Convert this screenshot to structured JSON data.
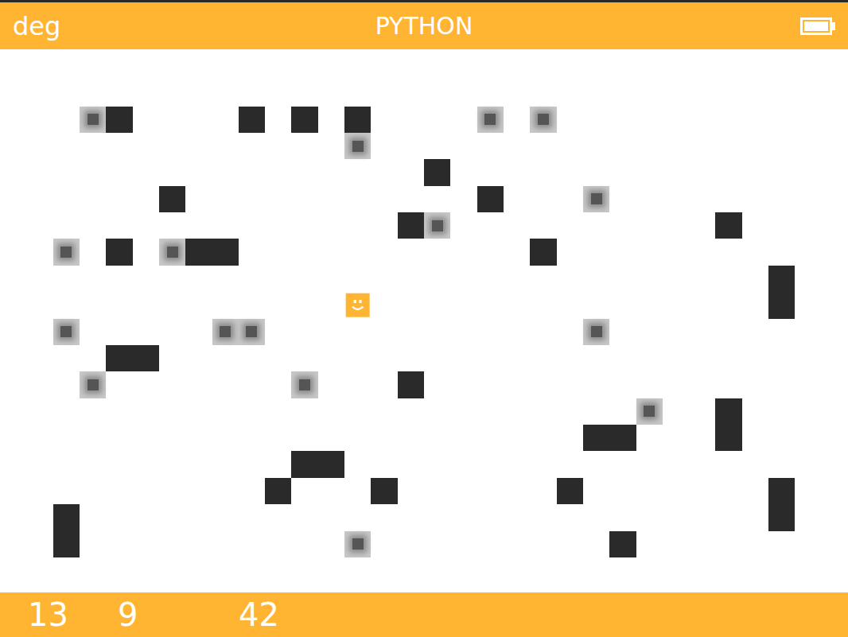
{
  "status_bar": {
    "angle_unit": "deg",
    "title": "PYTHON",
    "battery": {
      "level": 1
    }
  },
  "board": {
    "columns": 32,
    "rows": 24,
    "tiles": [
      {
        "kind": "crate",
        "col": 3,
        "row": 4
      },
      {
        "kind": "wall",
        "col": 4,
        "row": 4
      },
      {
        "kind": "wall",
        "col": 9,
        "row": 4
      },
      {
        "kind": "wall",
        "col": 11,
        "row": 4
      },
      {
        "kind": "wall",
        "col": 13,
        "row": 4
      },
      {
        "kind": "crate",
        "col": 18,
        "row": 4
      },
      {
        "kind": "crate",
        "col": 20,
        "row": 4
      },
      {
        "kind": "crate",
        "col": 13,
        "row": 5
      },
      {
        "kind": "wall",
        "col": 16,
        "row": 6
      },
      {
        "kind": "wall",
        "col": 6,
        "row": 7
      },
      {
        "kind": "wall",
        "col": 18,
        "row": 7
      },
      {
        "kind": "crate",
        "col": 22,
        "row": 7
      },
      {
        "kind": "wall",
        "col": 15,
        "row": 8
      },
      {
        "kind": "crate",
        "col": 16,
        "row": 8
      },
      {
        "kind": "wall",
        "col": 27,
        "row": 8
      },
      {
        "kind": "crate",
        "col": 2,
        "row": 9
      },
      {
        "kind": "wall",
        "col": 4,
        "row": 9
      },
      {
        "kind": "crate",
        "col": 6,
        "row": 9
      },
      {
        "kind": "wall",
        "col": 7,
        "row": 9
      },
      {
        "kind": "wall",
        "col": 8,
        "row": 9
      },
      {
        "kind": "wall",
        "col": 20,
        "row": 9
      },
      {
        "kind": "wall",
        "col": 29,
        "row": 10
      },
      {
        "kind": "wall",
        "col": 29,
        "row": 11
      },
      {
        "kind": "player",
        "col": 13,
        "row": 11
      },
      {
        "kind": "crate",
        "col": 2,
        "row": 12
      },
      {
        "kind": "crate",
        "col": 8,
        "row": 12
      },
      {
        "kind": "crate",
        "col": 9,
        "row": 12
      },
      {
        "kind": "crate",
        "col": 22,
        "row": 12
      },
      {
        "kind": "wall",
        "col": 4,
        "row": 13
      },
      {
        "kind": "wall",
        "col": 5,
        "row": 13
      },
      {
        "kind": "crate",
        "col": 3,
        "row": 14
      },
      {
        "kind": "crate",
        "col": 11,
        "row": 14
      },
      {
        "kind": "wall",
        "col": 15,
        "row": 14
      },
      {
        "kind": "crate",
        "col": 24,
        "row": 15
      },
      {
        "kind": "wall",
        "col": 27,
        "row": 15
      },
      {
        "kind": "wall",
        "col": 27,
        "row": 16
      },
      {
        "kind": "wall",
        "col": 22,
        "row": 16
      },
      {
        "kind": "wall",
        "col": 23,
        "row": 16
      },
      {
        "kind": "wall",
        "col": 11,
        "row": 17
      },
      {
        "kind": "wall",
        "col": 12,
        "row": 17
      },
      {
        "kind": "wall",
        "col": 10,
        "row": 18
      },
      {
        "kind": "wall",
        "col": 14,
        "row": 18
      },
      {
        "kind": "wall",
        "col": 21,
        "row": 18
      },
      {
        "kind": "wall",
        "col": 29,
        "row": 18
      },
      {
        "kind": "wall",
        "col": 29,
        "row": 19
      },
      {
        "kind": "wall",
        "col": 2,
        "row": 19
      },
      {
        "kind": "wall",
        "col": 2,
        "row": 20
      },
      {
        "kind": "crate",
        "col": 13,
        "row": 20
      },
      {
        "kind": "wall",
        "col": 23,
        "row": 20
      }
    ]
  },
  "score_bar": [
    "13",
    "9",
    "42"
  ]
}
